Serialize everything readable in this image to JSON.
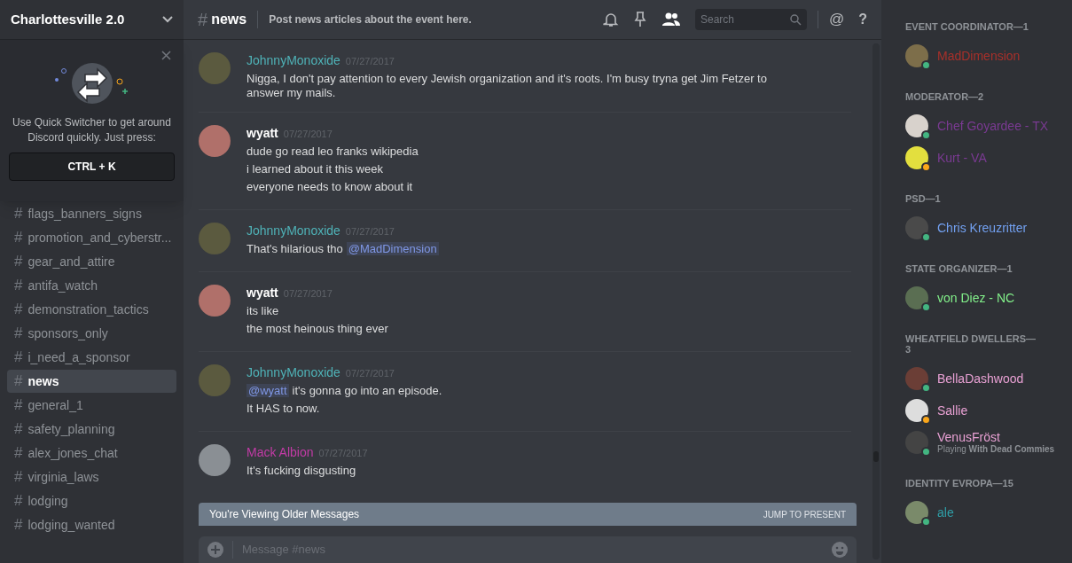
{
  "server": {
    "name": "Charlottesville 2.0"
  },
  "quick_switcher": {
    "text": "Use Quick Switcher to get around Discord quickly. Just press:",
    "shortcut": "CTRL + K"
  },
  "channels": [
    {
      "name": "flags_banners_signs",
      "selected": false
    },
    {
      "name": "promotion_and_cyberstr...",
      "selected": false
    },
    {
      "name": "gear_and_attire",
      "selected": false
    },
    {
      "name": "antifa_watch",
      "selected": false
    },
    {
      "name": "demonstration_tactics",
      "selected": false
    },
    {
      "name": "sponsors_only",
      "selected": false
    },
    {
      "name": "i_need_a_sponsor",
      "selected": false
    },
    {
      "name": "news",
      "selected": true
    },
    {
      "name": "general_1",
      "selected": false
    },
    {
      "name": "safety_planning",
      "selected": false
    },
    {
      "name": "alex_jones_chat",
      "selected": false
    },
    {
      "name": "virginia_laws",
      "selected": false
    },
    {
      "name": "lodging",
      "selected": false
    },
    {
      "name": "lodging_wanted",
      "selected": false
    }
  ],
  "header": {
    "hash": "#",
    "channel": "news",
    "topic": "Post news articles about the event here.",
    "search_placeholder": "Search",
    "mention_glyph": "@",
    "help_glyph": "?"
  },
  "messages": [
    {
      "author": "JohnnyMonoxide",
      "color": "#4fb3b8",
      "time": "07/27/2017",
      "lines": [
        [
          {
            "kind": "text",
            "text": "Nigga, I don't pay attention to every Jewish organization and it's roots. I'm busy tryna get Jim Fetzer to answer my mails."
          }
        ]
      ]
    },
    {
      "author": "wyatt",
      "color": "#ffffff",
      "time": "07/27/2017",
      "lines": [
        [
          {
            "kind": "text",
            "text": "dude go read leo franks wikipedia"
          }
        ],
        [
          {
            "kind": "text",
            "text": "i learned about it this week"
          }
        ],
        [
          {
            "kind": "text",
            "text": "everyone needs to know about it"
          }
        ]
      ]
    },
    {
      "author": "JohnnyMonoxide",
      "color": "#4fb3b8",
      "time": "07/27/2017",
      "lines": [
        [
          {
            "kind": "text",
            "text": "That's hilarious tho"
          },
          {
            "kind": "mention",
            "text": "@MadDimension"
          }
        ]
      ]
    },
    {
      "author": "wyatt",
      "color": "#ffffff",
      "time": "07/27/2017",
      "lines": [
        [
          {
            "kind": "text",
            "text": "its like"
          }
        ],
        [
          {
            "kind": "text",
            "text": "the most heinous thing ever"
          }
        ]
      ]
    },
    {
      "author": "JohnnyMonoxide",
      "color": "#4fb3b8",
      "time": "07/27/2017",
      "lines": [
        [
          {
            "kind": "mention",
            "text": "@wyatt"
          },
          {
            "kind": "text",
            "text": "it's gonna go into an episode."
          }
        ],
        [
          {
            "kind": "text",
            "text": "It HAS to now."
          }
        ]
      ]
    },
    {
      "author": "Mack Albion",
      "color": "#c23ba6",
      "time": "07/27/2017",
      "lines": [
        [
          {
            "kind": "text",
            "text": "It's fucking disgusting"
          }
        ]
      ]
    }
  ],
  "older_banner": {
    "text": "You're Viewing Older Messages",
    "action": "JUMP TO PRESENT"
  },
  "composer": {
    "placeholder": "Message #news"
  },
  "member_groups": [
    {
      "title": "EVENT COORDINATOR—1",
      "members": [
        {
          "name": "MadDimension",
          "color": "#a8302a",
          "idle": false
        }
      ]
    },
    {
      "title": "MODERATOR—2",
      "members": [
        {
          "name": "Chef Goyardee - TX",
          "color": "#7a3a92",
          "idle": false
        },
        {
          "name": "Kurt - VA",
          "color": "#7a3a92",
          "idle": true
        }
      ]
    },
    {
      "title": "PSD—1",
      "members": [
        {
          "name": "Chris Kreuzritter",
          "color": "#72a0f0",
          "idle": false
        }
      ]
    },
    {
      "title": "STATE ORGANIZER—1",
      "members": [
        {
          "name": "von Diez - NC",
          "color": "#82f08a",
          "idle": false
        }
      ]
    },
    {
      "title": "WHEATFIELD DWELLERS—3",
      "members": [
        {
          "name": "BellaDashwood",
          "color": "#e9a1d4",
          "idle": false
        },
        {
          "name": "Sallie",
          "color": "#e9a1d4",
          "idle": true
        },
        {
          "name": "VenusFröst",
          "color": "#e9a1d4",
          "idle": false,
          "activity": "Playing **With Dead Commies**"
        }
      ]
    },
    {
      "title": "IDENTITY EVROPA—15",
      "members": [
        {
          "name": "ale",
          "color": "#2f9fa8",
          "idle": false
        }
      ]
    }
  ]
}
